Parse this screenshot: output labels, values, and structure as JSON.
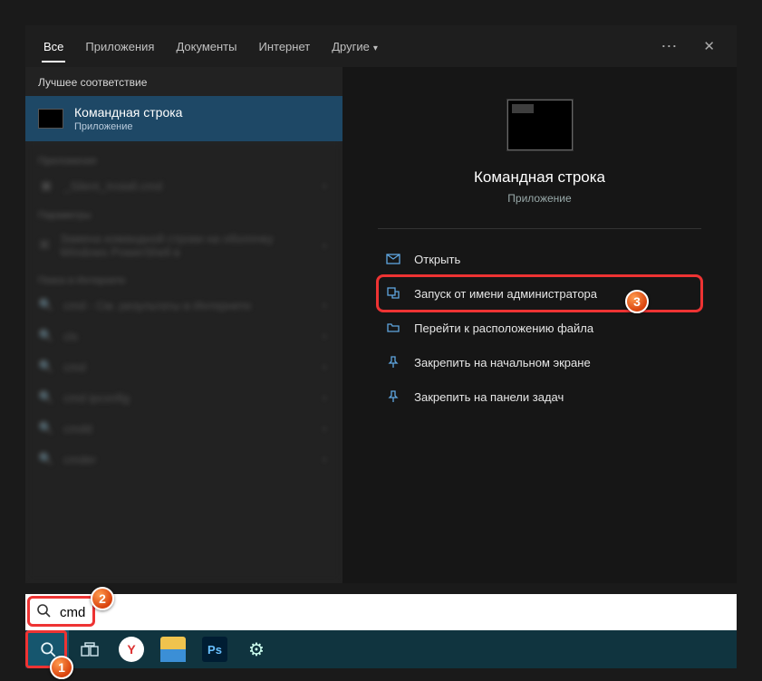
{
  "tabs": {
    "all": "Все",
    "apps": "Приложения",
    "docs": "Документы",
    "internet": "Интернет",
    "other": "Другие"
  },
  "left": {
    "best_label": "Лучшее соответствие",
    "best_title": "Командная строка",
    "best_sub": "Приложение",
    "cat_apps": "Приложения",
    "cat_params": "Параметры",
    "cat_web": "Поиск в Интернете",
    "items": {
      "silent": "_Silent_Install.cmd",
      "ps_replace": "Замена командной строки на оболочку Windows PowerShell в",
      "web1": "cmd - См. результаты в Интернете",
      "web2": "cls",
      "web3": "cmd",
      "web4": "cmd ipconfig",
      "web5": "cmdd",
      "web6": "cmder"
    }
  },
  "right": {
    "title": "Командная строка",
    "sub": "Приложение",
    "actions": {
      "open": "Открыть",
      "admin": "Запуск от имени администратора",
      "location": "Перейти к расположению файла",
      "pin_start": "Закрепить на начальном экране",
      "pin_task": "Закрепить на панели задач"
    }
  },
  "search": {
    "value": "cmd",
    "placeholder": ""
  },
  "badges": {
    "b1": "1",
    "b2": "2",
    "b3": "3"
  }
}
